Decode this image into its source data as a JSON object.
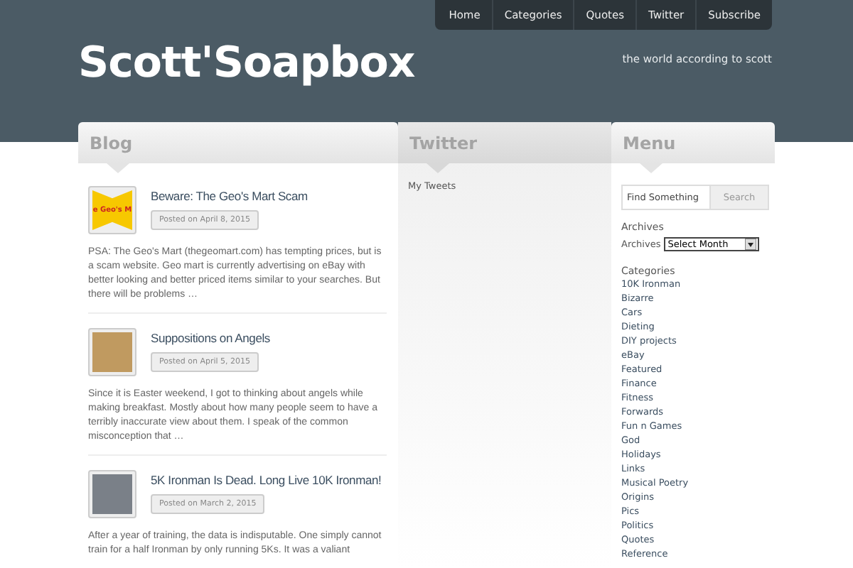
{
  "nav": [
    {
      "label": "Home"
    },
    {
      "label": "Categories"
    },
    {
      "label": "Quotes"
    },
    {
      "label": "Twitter"
    },
    {
      "label": "Subscribe"
    }
  ],
  "site": {
    "title": "Scott'Soapbox",
    "tagline": "the world according to scott"
  },
  "blog": {
    "heading": "Blog",
    "posts": [
      {
        "title": "Beware: The Geo's Mart Scam",
        "date": "Posted on April 8, 2015",
        "thumb_text": "e Geo's M",
        "excerpt": "PSA: The Geo's Mart (thegeomart.com) has tempting prices, but is a scam website. Geo mart is currently advertising on eBay with better looking and better priced items similar to your searches. But there will be problems …"
      },
      {
        "title": "Suppositions on Angels",
        "date": "Posted on April 5, 2015",
        "excerpt": "Since it is Easter weekend, I got to thinking about angels while making breakfast. Mostly about how many people seem to have a terribly inaccurate view about them. I speak of the common misconception that …"
      },
      {
        "title": "5K Ironman Is Dead. Long Live 10K Ironman!",
        "date": "Posted on March 2, 2015",
        "excerpt": "After a year of training, the data is indisputable. One simply cannot train for a half Ironman by only running 5Ks. It was a valiant"
      }
    ]
  },
  "twitter": {
    "heading": "Twitter",
    "link": "My Tweets"
  },
  "menu": {
    "heading": "Menu",
    "search": {
      "placeholder": "Find Something",
      "button": "Search"
    },
    "archives": {
      "heading": "Archives",
      "label": "Archives",
      "select": "Select Month"
    },
    "categories": {
      "heading": "Categories",
      "items": [
        "10K Ironman",
        "Bizarre",
        "Cars",
        "Dieting",
        "DIY projects",
        "eBay",
        "Featured",
        "Finance",
        "Fitness",
        "Forwards",
        "Fun n Games",
        "God",
        "Holidays",
        "Links",
        "Musical Poetry",
        "Origins",
        "Pics",
        "Politics",
        "Quotes",
        "Reference"
      ]
    }
  }
}
